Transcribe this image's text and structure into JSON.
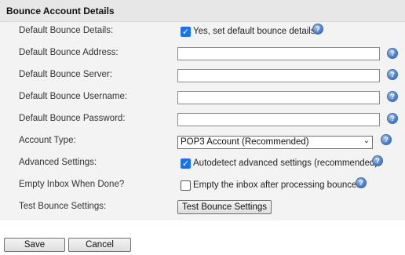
{
  "section": {
    "title": "Bounce Account Details"
  },
  "fields": {
    "default_details": {
      "label": "Default Bounce Details:",
      "checkbox_label": "Yes, set default bounce details",
      "checked": true
    },
    "address": {
      "label": "Default Bounce Address:",
      "value": ""
    },
    "server": {
      "label": "Default Bounce Server:",
      "value": ""
    },
    "username": {
      "label": "Default Bounce Username:",
      "value": ""
    },
    "password": {
      "label": "Default Bounce Password:",
      "value": ""
    },
    "account_type": {
      "label": "Account Type:",
      "selected": "POP3 Account (Recommended)"
    },
    "advanced": {
      "label": "Advanced Settings:",
      "checkbox_label": "Autodetect advanced settings (recommended)",
      "checked": true
    },
    "empty_inbox": {
      "label": "Empty Inbox When Done?",
      "checkbox_label": "Empty the inbox after processing bounces",
      "checked": false
    },
    "test": {
      "label": "Test Bounce Settings:",
      "button_label": "Test Bounce Settings"
    }
  },
  "help_icon": {
    "glyph": "?",
    "icon": "help-icon"
  },
  "checkmark": "✓",
  "select_arrow": "⌄",
  "actions": {
    "save_label": "Save",
    "cancel_label": "Cancel"
  },
  "colors": {
    "checkbox_checked": "#1a73e8",
    "panel_bg": "#f3f3f3",
    "header_bg": "#e7e7e7"
  }
}
